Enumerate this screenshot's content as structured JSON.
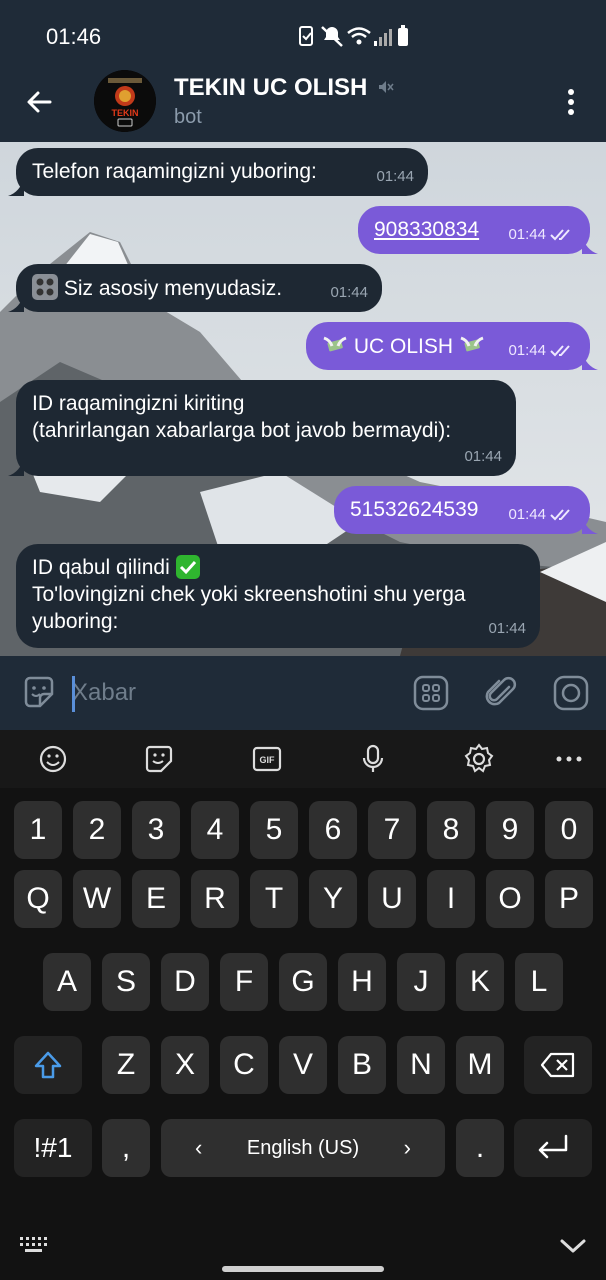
{
  "status_bar": {
    "time": "01:46"
  },
  "header": {
    "title": "TEKIN UC OLISH",
    "subtitle": "bot",
    "avatar_label": "TEKIN"
  },
  "messages": [
    {
      "dir": "in",
      "text": "Telefon raqamingizni yuboring:",
      "time": "01:44"
    },
    {
      "dir": "out",
      "text": "908330834",
      "time": "01:44"
    },
    {
      "dir": "in",
      "text": "Siz asosiy menyudasiz.",
      "time": "01:44"
    },
    {
      "dir": "out",
      "text": "UC OLISH",
      "time": "01:44"
    },
    {
      "dir": "in",
      "line1": "ID raqamingizni kiriting",
      "line2": "(tahrirlangan xabarlarga bot javob bermaydi):",
      "time": "01:44"
    },
    {
      "dir": "out",
      "text": "51532624539",
      "time": "01:44"
    },
    {
      "dir": "in",
      "line1": "ID qabul qilindi",
      "line2": "To'lovingizni chek yoki skreenshotini shu yerga",
      "line3": "yuboring:",
      "time": "01:44"
    }
  ],
  "input": {
    "placeholder": "Xabar"
  },
  "keyboard": {
    "row1": [
      "1",
      "2",
      "3",
      "4",
      "5",
      "6",
      "7",
      "8",
      "9",
      "0"
    ],
    "row2": [
      "Q",
      "W",
      "E",
      "R",
      "T",
      "Y",
      "U",
      "I",
      "O",
      "P"
    ],
    "row3": [
      "A",
      "S",
      "D",
      "F",
      "G",
      "H",
      "J",
      "K",
      "L"
    ],
    "row4": [
      "Z",
      "X",
      "C",
      "V",
      "B",
      "N",
      "M"
    ],
    "symbols": "!#1",
    "comma": ",",
    "space": "English (US)",
    "period": "."
  },
  "icons": {
    "toolbar": [
      "emoji-icon",
      "sticker-icon",
      "gif-icon",
      "mic-icon",
      "settings-icon",
      "more-icon"
    ]
  }
}
